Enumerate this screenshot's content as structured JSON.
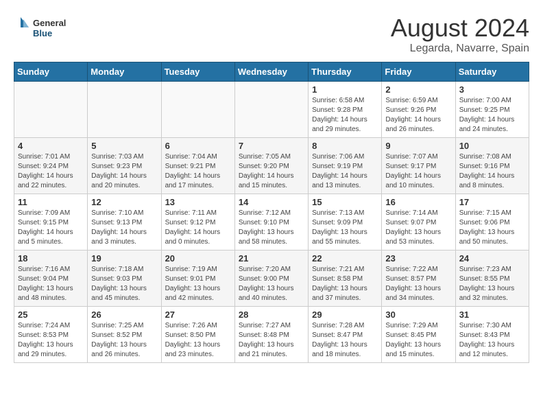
{
  "header": {
    "logo_general": "General",
    "logo_blue": "Blue",
    "title": "August 2024",
    "subtitle": "Legarda, Navarre, Spain"
  },
  "weekdays": [
    "Sunday",
    "Monday",
    "Tuesday",
    "Wednesday",
    "Thursday",
    "Friday",
    "Saturday"
  ],
  "weeks": [
    [
      {
        "day": "",
        "info": ""
      },
      {
        "day": "",
        "info": ""
      },
      {
        "day": "",
        "info": ""
      },
      {
        "day": "",
        "info": ""
      },
      {
        "day": "1",
        "info": "Sunrise: 6:58 AM\nSunset: 9:28 PM\nDaylight: 14 hours\nand 29 minutes."
      },
      {
        "day": "2",
        "info": "Sunrise: 6:59 AM\nSunset: 9:26 PM\nDaylight: 14 hours\nand 26 minutes."
      },
      {
        "day": "3",
        "info": "Sunrise: 7:00 AM\nSunset: 9:25 PM\nDaylight: 14 hours\nand 24 minutes."
      }
    ],
    [
      {
        "day": "4",
        "info": "Sunrise: 7:01 AM\nSunset: 9:24 PM\nDaylight: 14 hours\nand 22 minutes."
      },
      {
        "day": "5",
        "info": "Sunrise: 7:03 AM\nSunset: 9:23 PM\nDaylight: 14 hours\nand 20 minutes."
      },
      {
        "day": "6",
        "info": "Sunrise: 7:04 AM\nSunset: 9:21 PM\nDaylight: 14 hours\nand 17 minutes."
      },
      {
        "day": "7",
        "info": "Sunrise: 7:05 AM\nSunset: 9:20 PM\nDaylight: 14 hours\nand 15 minutes."
      },
      {
        "day": "8",
        "info": "Sunrise: 7:06 AM\nSunset: 9:19 PM\nDaylight: 14 hours\nand 13 minutes."
      },
      {
        "day": "9",
        "info": "Sunrise: 7:07 AM\nSunset: 9:17 PM\nDaylight: 14 hours\nand 10 minutes."
      },
      {
        "day": "10",
        "info": "Sunrise: 7:08 AM\nSunset: 9:16 PM\nDaylight: 14 hours\nand 8 minutes."
      }
    ],
    [
      {
        "day": "11",
        "info": "Sunrise: 7:09 AM\nSunset: 9:15 PM\nDaylight: 14 hours\nand 5 minutes."
      },
      {
        "day": "12",
        "info": "Sunrise: 7:10 AM\nSunset: 9:13 PM\nDaylight: 14 hours\nand 3 minutes."
      },
      {
        "day": "13",
        "info": "Sunrise: 7:11 AM\nSunset: 9:12 PM\nDaylight: 14 hours\nand 0 minutes."
      },
      {
        "day": "14",
        "info": "Sunrise: 7:12 AM\nSunset: 9:10 PM\nDaylight: 13 hours\nand 58 minutes."
      },
      {
        "day": "15",
        "info": "Sunrise: 7:13 AM\nSunset: 9:09 PM\nDaylight: 13 hours\nand 55 minutes."
      },
      {
        "day": "16",
        "info": "Sunrise: 7:14 AM\nSunset: 9:07 PM\nDaylight: 13 hours\nand 53 minutes."
      },
      {
        "day": "17",
        "info": "Sunrise: 7:15 AM\nSunset: 9:06 PM\nDaylight: 13 hours\nand 50 minutes."
      }
    ],
    [
      {
        "day": "18",
        "info": "Sunrise: 7:16 AM\nSunset: 9:04 PM\nDaylight: 13 hours\nand 48 minutes."
      },
      {
        "day": "19",
        "info": "Sunrise: 7:18 AM\nSunset: 9:03 PM\nDaylight: 13 hours\nand 45 minutes."
      },
      {
        "day": "20",
        "info": "Sunrise: 7:19 AM\nSunset: 9:01 PM\nDaylight: 13 hours\nand 42 minutes."
      },
      {
        "day": "21",
        "info": "Sunrise: 7:20 AM\nSunset: 9:00 PM\nDaylight: 13 hours\nand 40 minutes."
      },
      {
        "day": "22",
        "info": "Sunrise: 7:21 AM\nSunset: 8:58 PM\nDaylight: 13 hours\nand 37 minutes."
      },
      {
        "day": "23",
        "info": "Sunrise: 7:22 AM\nSunset: 8:57 PM\nDaylight: 13 hours\nand 34 minutes."
      },
      {
        "day": "24",
        "info": "Sunrise: 7:23 AM\nSunset: 8:55 PM\nDaylight: 13 hours\nand 32 minutes."
      }
    ],
    [
      {
        "day": "25",
        "info": "Sunrise: 7:24 AM\nSunset: 8:53 PM\nDaylight: 13 hours\nand 29 minutes."
      },
      {
        "day": "26",
        "info": "Sunrise: 7:25 AM\nSunset: 8:52 PM\nDaylight: 13 hours\nand 26 minutes."
      },
      {
        "day": "27",
        "info": "Sunrise: 7:26 AM\nSunset: 8:50 PM\nDaylight: 13 hours\nand 23 minutes."
      },
      {
        "day": "28",
        "info": "Sunrise: 7:27 AM\nSunset: 8:48 PM\nDaylight: 13 hours\nand 21 minutes."
      },
      {
        "day": "29",
        "info": "Sunrise: 7:28 AM\nSunset: 8:47 PM\nDaylight: 13 hours\nand 18 minutes."
      },
      {
        "day": "30",
        "info": "Sunrise: 7:29 AM\nSunset: 8:45 PM\nDaylight: 13 hours\nand 15 minutes."
      },
      {
        "day": "31",
        "info": "Sunrise: 7:30 AM\nSunset: 8:43 PM\nDaylight: 13 hours\nand 12 minutes."
      }
    ]
  ]
}
